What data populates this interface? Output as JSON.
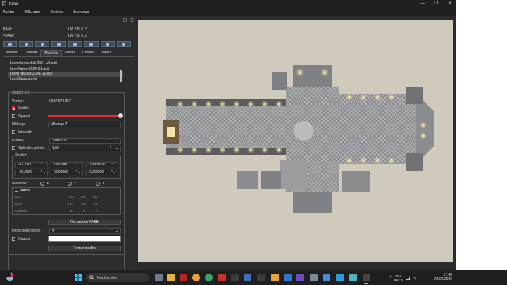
{
  "window": {
    "title": "ESlab",
    "controls": [
      "—",
      "❐",
      "✕"
    ]
  },
  "menu": [
    "Fichier",
    "Affichage",
    "Options",
    "À propos"
  ],
  "memory": {
    "ram_label": "RAM :",
    "ram_value": "196 739 613",
    "vram_label": "VRAM :",
    "vram_value": "196 739 613"
  },
  "tabs": [
    "Moteur",
    "Caméra",
    "Modèles",
    "Poses",
    "Coupes",
    "Vidéo"
  ],
  "active_tab": "Modèles",
  "files": [
    "LeonInterieurSol-2024-U1.octi",
    "LeonParvis-2024-U1.octi",
    "LeonTribunes-2024-U1.octi",
    "LeonPanneau.obj"
  ],
  "model": {
    "group_title": "Modèle 3D",
    "vertex_label": "Vertex :",
    "vertex_value": "5 587 872 257",
    "visible_label": "Visible",
    "opacity_label": "Opacité",
    "opacity_value": 1.0,
    "blend_label": "Mélange :",
    "blend_value": "Mélange Z",
    "intensity_label": "Intensité",
    "scale_label": "Échelle :",
    "scale_value": "1,000000",
    "pointsize_label": "Taille des points :",
    "pointsize_value": "1,00",
    "position_title": "Position",
    "pos_row1": [
      "-41,2500",
      "19,60000",
      "-239,9500"
    ],
    "pos_row2": [
      "-90,0000",
      "0,000000",
      "0,000000"
    ],
    "inversion_label": "Inversion :",
    "inv_x": "X",
    "inv_y": "Y",
    "inv_z": "Z",
    "aabb_label": "AABB",
    "aabb": {
      "min_label": "Min :",
      "max_label": "Max :",
      "center_label": "Gravité :",
      "min": [
        "-76",
        "-70",
        "-30"
      ],
      "max": [
        "133",
        "88",
        "34"
      ],
      "center": [
        "30",
        "8",
        "2"
      ]
    },
    "recalc_button": "Re-calculer AABB",
    "depth_label": "Profondeur octree :",
    "depth_value": "4",
    "color_label": "Couleur",
    "close_button": "Fermer modèle"
  },
  "taskbar": {
    "weather_badge": "1",
    "search_placeholder": "Rechercher",
    "lang_top": "FRA",
    "lang_bottom": "BEFR",
    "time": "17:48",
    "date": "24/04/2025"
  },
  "colors": {
    "accent": "#e03030",
    "viewport_bg": "#cfcabc",
    "panel_bg": "#2d2d2d"
  }
}
